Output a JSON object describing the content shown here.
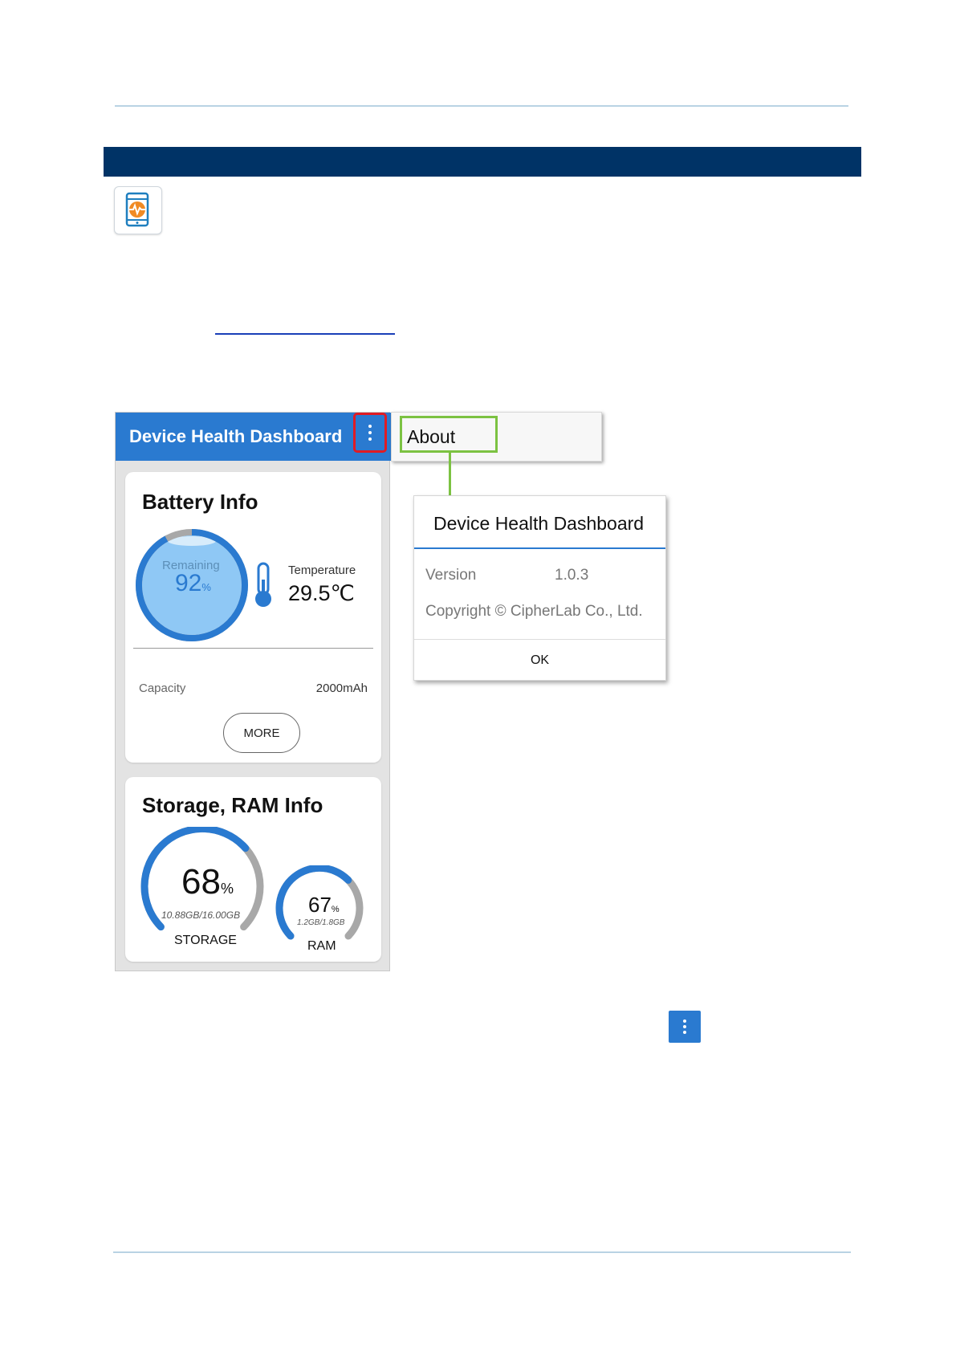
{
  "appbar": {
    "title": "Device Health Dashboard"
  },
  "menu": {
    "item": "About"
  },
  "battery": {
    "title": "Battery Info",
    "remaining_label": "Remaining",
    "remaining_value": "92",
    "remaining_unit": "%",
    "remaining_fraction": 0.92,
    "temperature_label": "Temperature",
    "temperature_value": "29.5℃",
    "capacity_label": "Capacity",
    "capacity_value": "2000mAh",
    "more_label": "MORE"
  },
  "storage": {
    "title": "Storage, RAM Info",
    "storage_value": "68",
    "storage_unit": "%",
    "storage_fraction": 0.68,
    "storage_detail": "10.88GB/16.00GB",
    "storage_label": "STORAGE",
    "ram_value": "67",
    "ram_unit": "%",
    "ram_fraction": 0.67,
    "ram_detail": "1.2GB/1.8GB",
    "ram_label": "RAM"
  },
  "dialog": {
    "title": "Device Health Dashboard",
    "version_label": "Version",
    "version_value": "1.0.3",
    "copyright": "Copyright © CipherLab Co., Ltd.",
    "ok_label": "OK"
  },
  "colors": {
    "header_band": "#003366",
    "appbar": "#2a7ad0",
    "highlight_red": "#e01b24",
    "highlight_green": "#7cc242",
    "gauge_blue": "#2a7ad0",
    "gauge_grey": "#a8a8a8"
  },
  "icons": [
    "device-health-app-icon",
    "kebab-menu-icon",
    "thermometer-icon"
  ]
}
